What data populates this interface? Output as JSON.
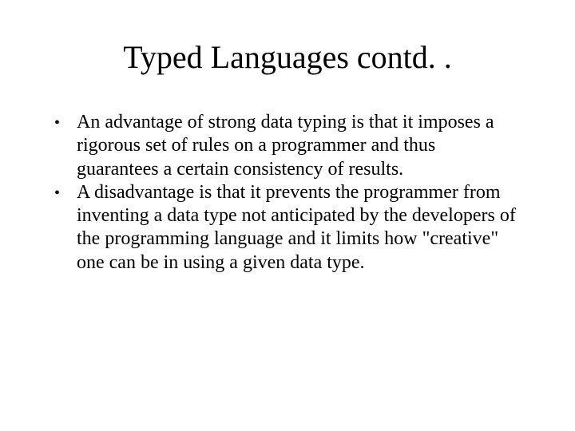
{
  "slide": {
    "title": "Typed Languages contd. .",
    "bullets": [
      {
        "marker": "•",
        "text": "An advantage of strong data typing is that it imposes a rigorous set of rules on a programmer and thus guarantees a certain consistency of results."
      },
      {
        "marker": "•",
        "text": " A disadvantage is that it prevents the programmer from inventing a data type not anticipated by the developers of the programming language and it limits how \"creative\" one can be in using a given data type."
      }
    ]
  }
}
